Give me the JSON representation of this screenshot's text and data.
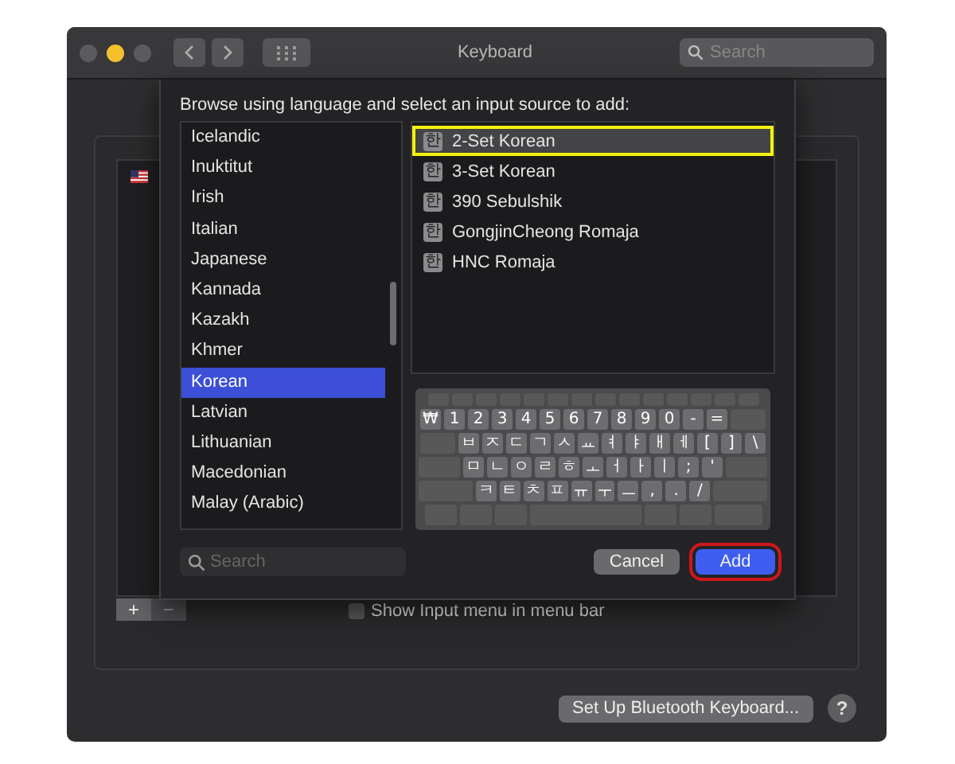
{
  "window": {
    "title": "Keyboard",
    "search_placeholder": "Search"
  },
  "sheet": {
    "prompt": "Browse using language and select an input source to add:",
    "languages": [
      {
        "label": "Icelandic",
        "selected": false
      },
      {
        "label": "Inuktitut",
        "selected": false
      },
      {
        "label": "Irish",
        "selected": false
      },
      {
        "label": "Italian",
        "selected": false
      },
      {
        "label": "Japanese",
        "selected": false
      },
      {
        "label": "Kannada",
        "selected": false
      },
      {
        "label": "Kazakh",
        "selected": false
      },
      {
        "label": "Khmer",
        "selected": false
      },
      {
        "label": "Korean",
        "selected": true
      },
      {
        "label": "Latvian",
        "selected": false
      },
      {
        "label": "Lithuanian",
        "selected": false
      },
      {
        "label": "Macedonian",
        "selected": false
      },
      {
        "label": "Malay (Arabic)",
        "selected": false
      }
    ],
    "sources": [
      {
        "icon": "한",
        "label": "2-Set Korean",
        "selected": true,
        "highlighted": true
      },
      {
        "icon": "한",
        "label": "3-Set Korean",
        "selected": false,
        "highlighted": false
      },
      {
        "icon": "한",
        "label": "390 Sebulshik",
        "selected": false,
        "highlighted": false
      },
      {
        "icon": "한",
        "label": "GongjinCheong Romaja",
        "selected": false,
        "highlighted": false
      },
      {
        "icon": "한",
        "label": "HNC Romaja",
        "selected": false,
        "highlighted": false
      }
    ],
    "keyboard_rows": [
      [
        "₩",
        "1",
        "2",
        "3",
        "4",
        "5",
        "6",
        "7",
        "8",
        "9",
        "0",
        "-",
        "="
      ],
      [
        "ㅂ",
        "ㅈ",
        "ㄷ",
        "ㄱ",
        "ㅅ",
        "ㅛ",
        "ㅕ",
        "ㅑ",
        "ㅐ",
        "ㅔ",
        "[",
        "]",
        "\\"
      ],
      [
        "ㅁ",
        "ㄴ",
        "ㅇ",
        "ㄹ",
        "ㅎ",
        "ㅗ",
        "ㅓ",
        "ㅏ",
        "ㅣ",
        ";",
        "'"
      ],
      [
        "ㅋ",
        "ㅌ",
        "ㅊ",
        "ㅍ",
        "ㅠ",
        "ㅜ",
        "ㅡ",
        ",",
        ".",
        "/"
      ]
    ],
    "search_placeholder": "Search",
    "buttons": [
      {
        "kind": "secondary",
        "label": "Cancel",
        "highlighted": false
      },
      {
        "kind": "primary",
        "label": "Add",
        "highlighted": true
      }
    ]
  },
  "add_remove": {
    "add": "+",
    "remove": "−"
  },
  "show_input_menu": {
    "label": "Show Input menu in menu bar",
    "checked": false
  },
  "bluetooth_button": "Set Up Bluetooth Keyboard...",
  "help_button": "?"
}
